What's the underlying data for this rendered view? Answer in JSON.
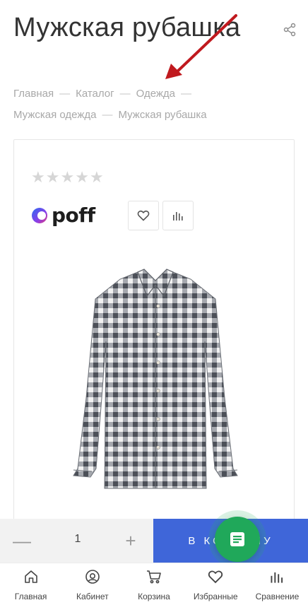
{
  "product": {
    "title": "Мужская рубашка"
  },
  "breadcrumb": [
    {
      "label": "Главная"
    },
    {
      "label": "Каталог"
    },
    {
      "label": "Одежда"
    },
    {
      "label": "Мужская одежда"
    },
    {
      "label": "Мужская рубашка"
    }
  ],
  "card": {
    "rating": {
      "value": 0,
      "max": 5,
      "glyph": "★"
    },
    "brand": {
      "name": "poff"
    }
  },
  "buy_bar": {
    "minus_glyph": "—",
    "quantity": "1",
    "plus_glyph": "+",
    "to_cart_label": "В корзину"
  },
  "bottom_nav": {
    "items": [
      {
        "label": "Главная",
        "icon": "home-icon"
      },
      {
        "label": "Кабинет",
        "icon": "user-circle-icon"
      },
      {
        "label": "Корзина",
        "icon": "cart-icon"
      },
      {
        "label": "Избранные",
        "icon": "heart-icon"
      },
      {
        "label": "Сравнение",
        "icon": "compare-bars-icon"
      }
    ]
  },
  "colors": {
    "accent_blue": "#3f66d9",
    "fab_green": "#20a85a",
    "annotation_arrow": "#c0191e",
    "text_muted": "#a8a8a8"
  }
}
